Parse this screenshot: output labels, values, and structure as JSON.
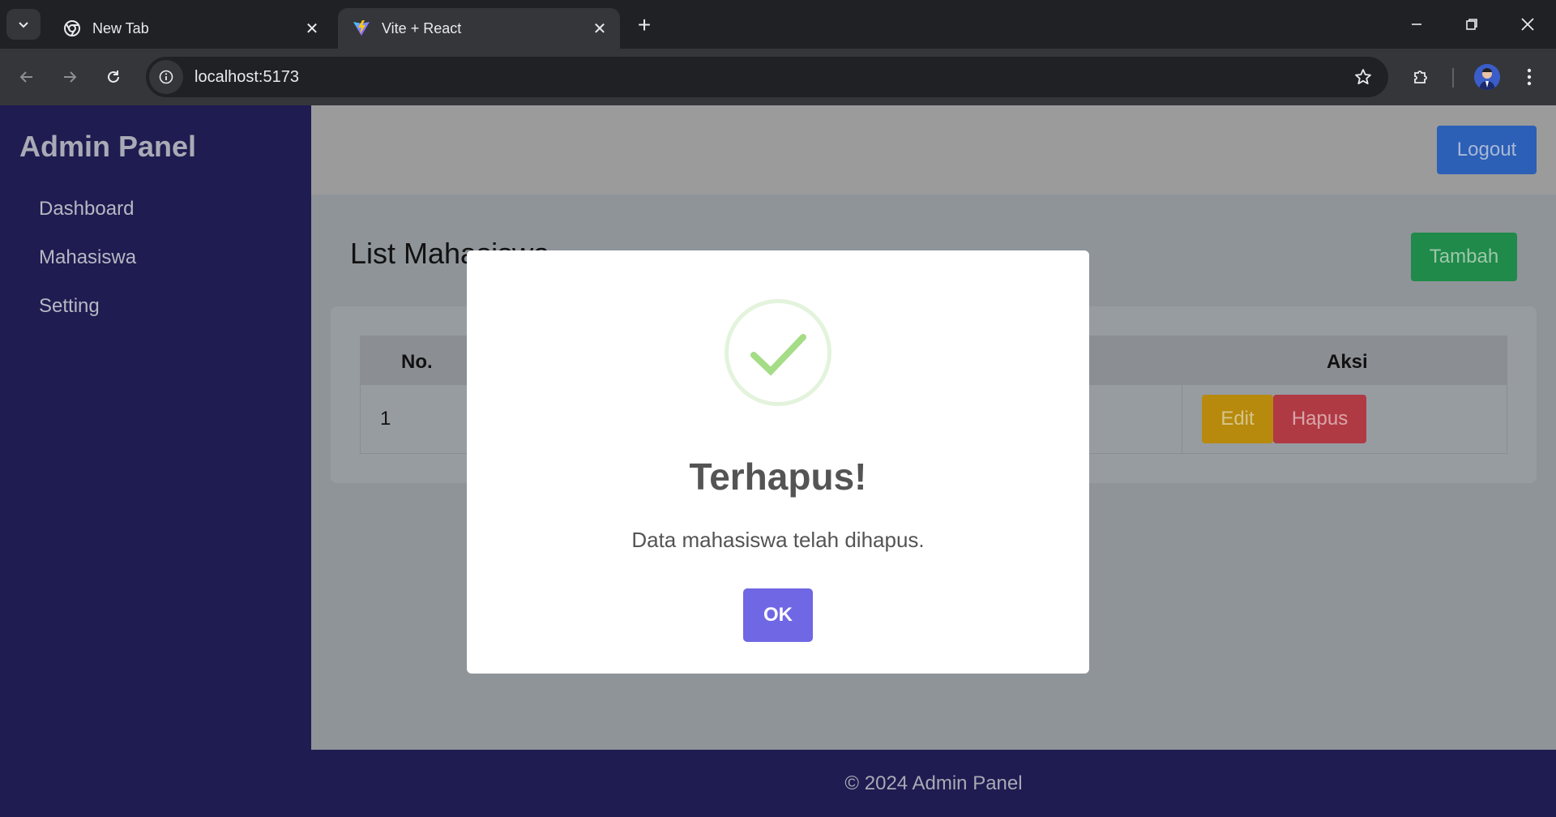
{
  "browser": {
    "tabs": [
      {
        "title": "New Tab",
        "icon": "chrome-icon",
        "active": false
      },
      {
        "title": "Vite + React",
        "icon": "vite-icon",
        "active": true
      }
    ],
    "url": "localhost:5173"
  },
  "sidebar": {
    "brand": "Admin Panel",
    "items": [
      {
        "label": "Dashboard"
      },
      {
        "label": "Mahasiswa"
      },
      {
        "label": "Setting"
      }
    ]
  },
  "topbar": {
    "logout_label": "Logout"
  },
  "main": {
    "title": "List Mahasiswa",
    "add_label": "Tambah",
    "table": {
      "headers": [
        "No.",
        "Aksi"
      ],
      "rows": [
        {
          "no": "1",
          "edit_label": "Edit",
          "delete_label": "Hapus"
        }
      ]
    }
  },
  "footer": {
    "text": "© 2024 Admin Panel"
  },
  "modal": {
    "icon": "success-check-icon",
    "title": "Terhapus!",
    "text": "Data mahasiswa telah dihapus.",
    "ok_label": "OK"
  },
  "colors": {
    "sidebar_bg": "#1e1c50",
    "logout": "#2c5fb6",
    "tambah": "#1f8a49",
    "edit": "#b78a0d",
    "hapus": "#b03a43",
    "ok": "#7067e4",
    "success": "#a5dc86"
  }
}
